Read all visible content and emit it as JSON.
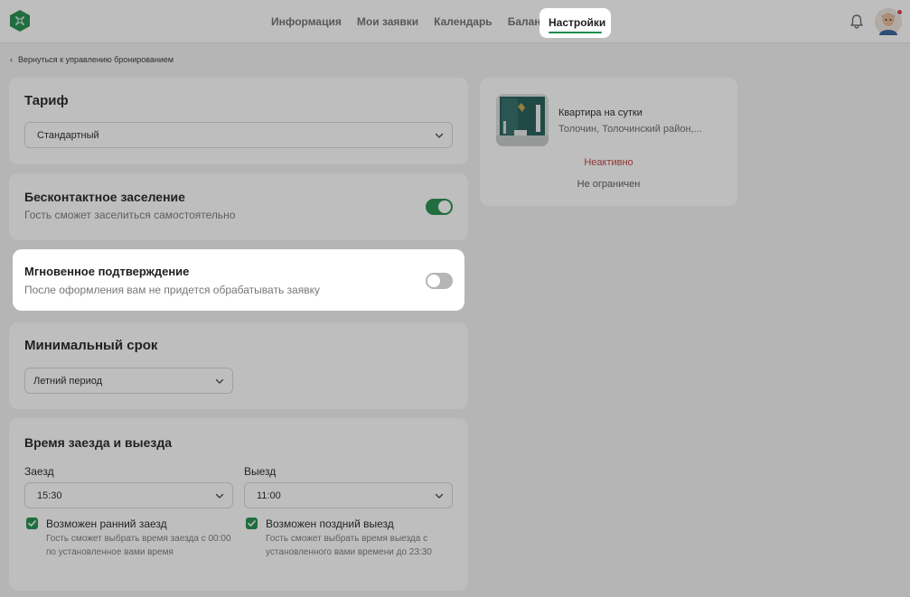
{
  "nav": {
    "items": [
      {
        "label": "Информация"
      },
      {
        "label": "Мои заявки"
      },
      {
        "label": "Календарь"
      },
      {
        "label": "Баланс"
      }
    ],
    "active_label": "Настройки"
  },
  "back_link": "Вернуться к управлению бронированием",
  "tariff": {
    "title": "Тариф",
    "selected": "Стандартный"
  },
  "contactless": {
    "title": "Бесконтактное заселение",
    "subtitle": "Гость сможет заселиться самостоятельно",
    "enabled": true
  },
  "instant": {
    "title": "Мгновенное подтверждение",
    "subtitle": "После оформления вам не придется обрабатывать заявку",
    "enabled": false
  },
  "min_term": {
    "title": "Минимальный срок",
    "selected": "Летний период"
  },
  "times": {
    "title": "Время заезда и выезда",
    "checkin_label": "Заезд",
    "checkin_value": "15:30",
    "checkout_label": "Выезд",
    "checkout_value": "11:00",
    "early_label": "Возможен ранний заезд",
    "early_desc": "Гость сможет выбрать время заезда с 00:00 по установленное вами время",
    "late_label": "Возможен поздний выезд",
    "late_desc": "Гость сможет выбрать время выезда с установленного вами времени до 23:30"
  },
  "listing": {
    "title": "Квартира на сутки",
    "address": "Толочин, Толочинский район,...",
    "status": "Неактивно",
    "limit": "Не ограничен"
  },
  "colors": {
    "accent": "#1e8c4a",
    "inactive": "#c23b3b",
    "toggle_off": "#b5b5b5"
  }
}
